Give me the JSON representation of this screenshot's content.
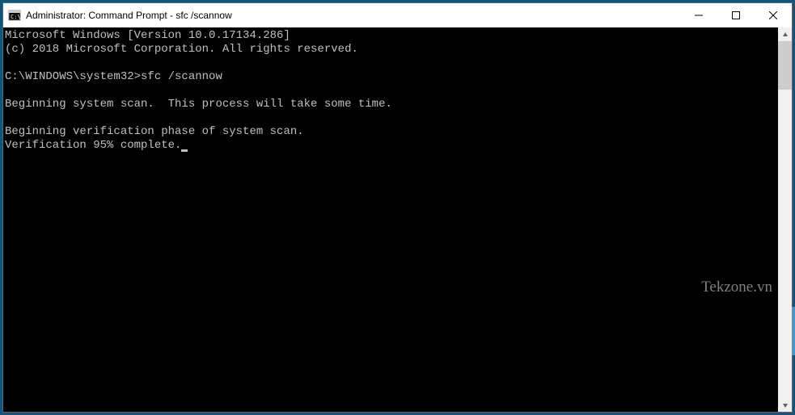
{
  "window": {
    "title": "Administrator: Command Prompt - sfc  /scannow"
  },
  "terminal": {
    "line1": "Microsoft Windows [Version 10.0.17134.286]",
    "line2": "(c) 2018 Microsoft Corporation. All rights reserved.",
    "blank1": "",
    "prompt_line": "C:\\WINDOWS\\system32>sfc /scannow",
    "blank2": "",
    "scan_line": "Beginning system scan.  This process will take some time.",
    "blank3": "",
    "verify_line1": "Beginning verification phase of system scan.",
    "verify_line2": "Verification 95% complete."
  },
  "watermark": "Tekzone.vn"
}
